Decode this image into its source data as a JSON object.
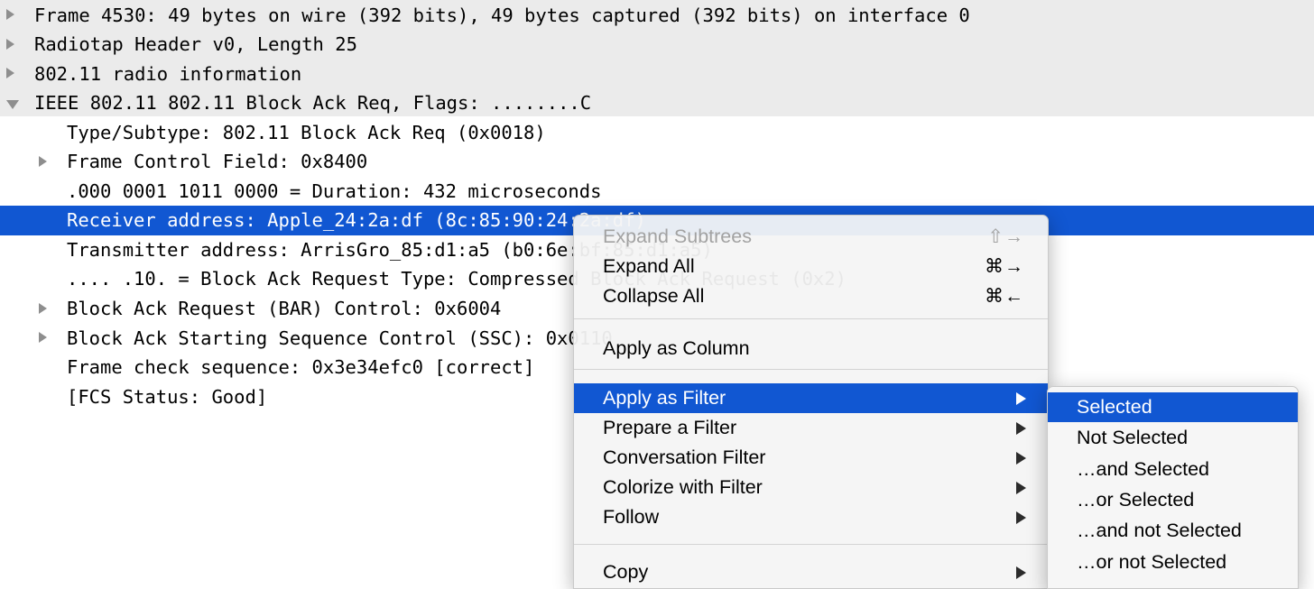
{
  "colors": {
    "selection_blue": "#1157d2",
    "tree_shade": "#ebebeb",
    "menu_bg": "#f4f4f4",
    "disabled_text": "#a2a2a2",
    "twisty_gray": "#8e8e8e"
  },
  "packet_tree": {
    "rows": [
      {
        "text": "Frame 4530: 49 bytes on wire (392 bits), 49 bytes captured (392 bits) on interface 0",
        "indent": 0,
        "twisty": "collapsed",
        "selected": false
      },
      {
        "text": "Radiotap Header v0, Length 25",
        "indent": 0,
        "twisty": "collapsed",
        "selected": false
      },
      {
        "text": "802.11 radio information",
        "indent": 0,
        "twisty": "collapsed",
        "selected": false
      },
      {
        "text": "IEEE 802.11 802.11 Block Ack Req, Flags: ........C",
        "indent": 0,
        "twisty": "expanded",
        "selected": false
      },
      {
        "text": "Type/Subtype: 802.11 Block Ack Req (0x0018)",
        "indent": 1,
        "twisty": "none",
        "selected": false
      },
      {
        "text": "Frame Control Field: 0x8400",
        "indent": 1,
        "twisty": "collapsed",
        "selected": false
      },
      {
        "text": ".000 0001 1011 0000 = Duration: 432 microseconds",
        "indent": 1,
        "twisty": "none",
        "selected": false
      },
      {
        "text": "Receiver address: Apple_24:2a:df (8c:85:90:24:2a:df)",
        "indent": 1,
        "twisty": "none",
        "selected": true
      },
      {
        "text": "Transmitter address: ArrisGro_85:d1:a5 (b0:6e:bf:85:d1:a5)",
        "indent": 1,
        "twisty": "none",
        "selected": false
      },
      {
        "text": ".... .10. = Block Ack Request Type: Compressed Block Ack Request (0x2)",
        "indent": 1,
        "twisty": "none",
        "selected": false
      },
      {
        "text": "Block Ack Request (BAR) Control: 0x6004",
        "indent": 1,
        "twisty": "collapsed",
        "selected": false
      },
      {
        "text": "Block Ack Starting Sequence Control (SSC): 0x0110",
        "indent": 1,
        "twisty": "collapsed",
        "selected": false
      },
      {
        "text": "Frame check sequence: 0x3e34efc0 [correct]",
        "indent": 1,
        "twisty": "none",
        "selected": false
      },
      {
        "text": "[FCS Status: Good]",
        "indent": 1,
        "twisty": "none",
        "selected": false
      }
    ]
  },
  "context_menu": {
    "items": [
      {
        "label": "Expand Subtrees",
        "shortcut": "⇧→",
        "disabled": true,
        "submenu": false,
        "highlighted": false
      },
      {
        "label": "Expand All",
        "shortcut": "⌘→",
        "disabled": false,
        "submenu": false,
        "highlighted": false
      },
      {
        "label": "Collapse All",
        "shortcut": "⌘←",
        "disabled": false,
        "submenu": false,
        "highlighted": false
      },
      {
        "label": "Apply as Column",
        "shortcut": "",
        "disabled": false,
        "submenu": false,
        "highlighted": false
      },
      {
        "label": "Apply as Filter",
        "shortcut": "",
        "disabled": false,
        "submenu": true,
        "highlighted": true
      },
      {
        "label": "Prepare a Filter",
        "shortcut": "",
        "disabled": false,
        "submenu": true,
        "highlighted": false
      },
      {
        "label": "Conversation Filter",
        "shortcut": "",
        "disabled": false,
        "submenu": true,
        "highlighted": false
      },
      {
        "label": "Colorize with Filter",
        "shortcut": "",
        "disabled": false,
        "submenu": true,
        "highlighted": false
      },
      {
        "label": "Follow",
        "shortcut": "",
        "disabled": false,
        "submenu": true,
        "highlighted": false
      },
      {
        "label": "Copy",
        "shortcut": "",
        "disabled": false,
        "submenu": true,
        "highlighted": false
      }
    ]
  },
  "submenu": {
    "title": "Apply as Filter",
    "items": [
      {
        "label": "Selected",
        "highlighted": true
      },
      {
        "label": "Not Selected",
        "highlighted": false
      },
      {
        "label": "…and Selected",
        "highlighted": false
      },
      {
        "label": "…or Selected",
        "highlighted": false
      },
      {
        "label": "…and not Selected",
        "highlighted": false
      },
      {
        "label": "…or not Selected",
        "highlighted": false
      }
    ]
  }
}
